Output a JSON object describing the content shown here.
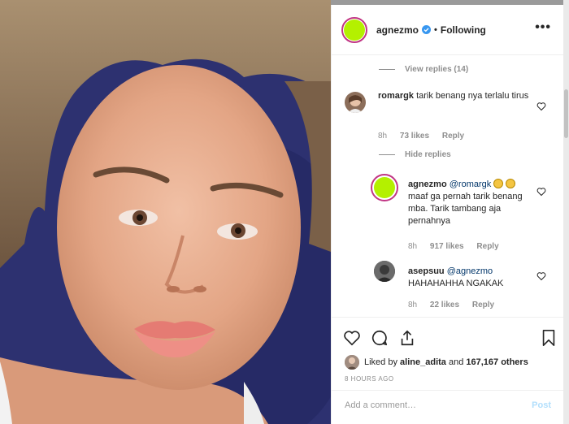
{
  "post": {
    "author": "agnezmo",
    "separator": "•",
    "follow_status": "Following",
    "more_label": "•••",
    "avatar_color": "#b4f000"
  },
  "comments": {
    "view_replies_label": "View replies (14)",
    "hide_replies_label": "Hide replies",
    "items": [
      {
        "username": "romargk",
        "text": "tarik benang nya terlalu tirus",
        "time": "8h",
        "likes": "73 likes",
        "reply_label": "Reply"
      },
      {
        "username": "agnezmo",
        "mention": "@romargk",
        "text": "maaf ga pernah tarik benang mba. Tarik tambang aja pernahnya",
        "time": "8h",
        "likes": "917 likes",
        "reply_label": "Reply"
      },
      {
        "username": "asepsuu",
        "mention": "@agnezmo",
        "text": "HAHAHAHHA NGAKAK",
        "time": "8h",
        "likes": "22 likes",
        "reply_label": "Reply"
      }
    ]
  },
  "actions": {
    "liked_prefix": "Liked by",
    "liked_user": "aline_adita",
    "liked_and": "and",
    "liked_count": "167,167 others",
    "timestamp": "8 HOURS AGO",
    "comment_placeholder": "Add a comment…",
    "post_label": "Post"
  },
  "icons": [
    "verified-icon",
    "heart-icon",
    "comment-icon",
    "share-icon",
    "bookmark-icon",
    "more-icon"
  ],
  "colors": {
    "story_ring": "#c13584",
    "verified": "#3897f0",
    "post_button_disabled": "#b2dffc"
  }
}
